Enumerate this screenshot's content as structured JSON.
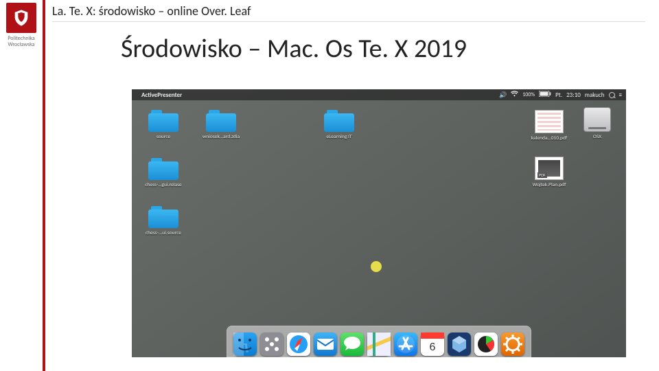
{
  "university": {
    "line1": "Politechnika",
    "line2": "Wrocławska"
  },
  "breadcrumb": "La. Te. X: środowisko – online Over. Leaf",
  "title": "Środowisko – Mac. Os Te. X 2019",
  "mac": {
    "menubar": {
      "app": "ActivePresenter",
      "battery_pct": "100%",
      "weekday": "Pt.",
      "time": "23:10",
      "user": "makuch"
    },
    "desktop": {
      "folders": [
        {
          "label": "source"
        },
        {
          "label": "wniosek…ard.zdia"
        },
        {
          "label": "eLearning IT"
        },
        {
          "label": "chess-…gui.relase"
        },
        {
          "label": "chess-…ui.source"
        }
      ],
      "files": [
        {
          "label": "kalenda…010.pdf",
          "kind": "spread"
        },
        {
          "label": "Wojtek.Plan.pdf",
          "kind": "pdf"
        }
      ],
      "drive": {
        "label": "OSX"
      }
    },
    "dock": [
      "finder",
      "launchpad",
      "safari",
      "mail",
      "messages",
      "maps",
      "appstore",
      "calendar",
      "virtualbox",
      "activity",
      "preferences"
    ]
  }
}
